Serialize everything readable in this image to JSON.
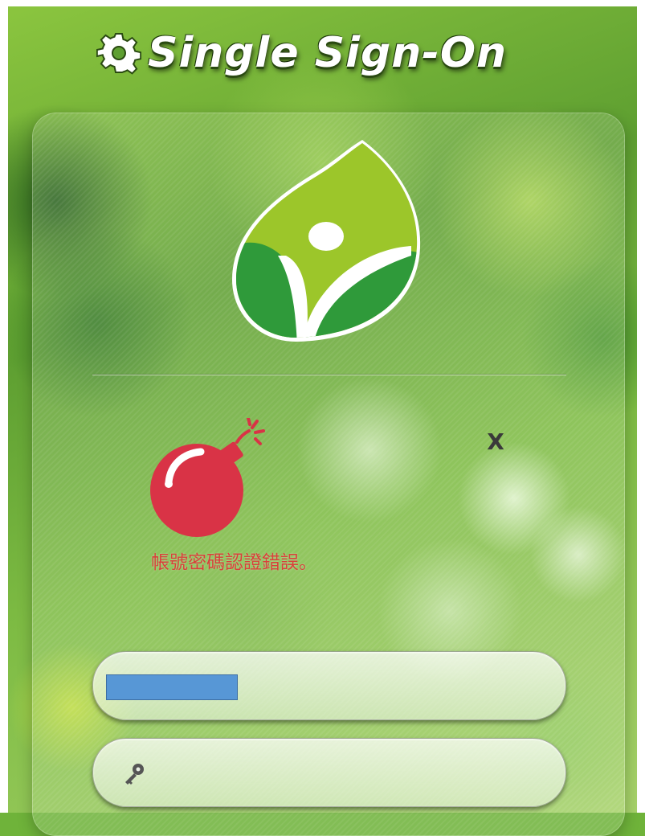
{
  "header": {
    "title": "Single Sign-On",
    "icon": "gear-icon"
  },
  "logo": {
    "icon": "school-leaf-logo"
  },
  "alert": {
    "icon": "bomb-icon",
    "close_label": "X",
    "message": "帳號密碼認證錯誤。",
    "message_color": "#d9403a"
  },
  "form": {
    "username": {
      "value": "",
      "placeholder": "",
      "redacted": true,
      "redact_color": "#5797d6"
    },
    "password": {
      "value": "",
      "placeholder": "",
      "icon": "key-icon"
    }
  },
  "colors": {
    "background": "#6fb33a",
    "logo_light_green": "#9cc62a",
    "logo_dark_green": "#2f9a3a"
  }
}
